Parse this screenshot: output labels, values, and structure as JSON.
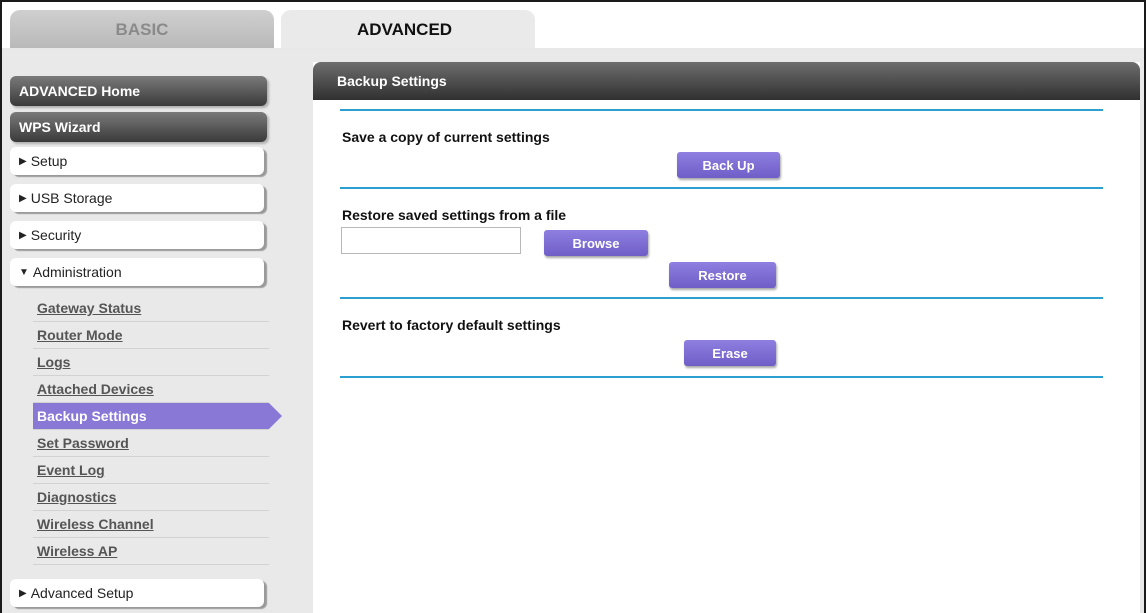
{
  "tabs": {
    "basic": "BASIC",
    "advanced": "ADVANCED"
  },
  "sidebar": {
    "advanced_home": "ADVANCED Home",
    "wps_wizard": "WPS Wizard",
    "setup": "Setup",
    "usb_storage": "USB Storage",
    "security": "Security",
    "administration": "Administration",
    "admin_items": [
      "Gateway Status",
      "Router Mode",
      "Logs",
      "Attached Devices",
      "Backup Settings",
      "Set Password",
      "Event Log",
      "Diagnostics",
      "Wireless Channel",
      "Wireless AP"
    ],
    "active_item": "Backup Settings",
    "advanced_setup": "Advanced Setup"
  },
  "panel": {
    "title": "Backup Settings",
    "save_label": "Save a copy of current settings",
    "backup_button": "Back Up",
    "restore_label": "Restore saved settings from a file",
    "file_value": "",
    "browse_button": "Browse",
    "restore_button": "Restore",
    "revert_label": "Revert to factory default settings",
    "erase_button": "Erase"
  },
  "colors": {
    "accent_purple": "#8a78d6",
    "divider_blue": "#2b9fd0",
    "header_dark": "#3a3a3a"
  }
}
